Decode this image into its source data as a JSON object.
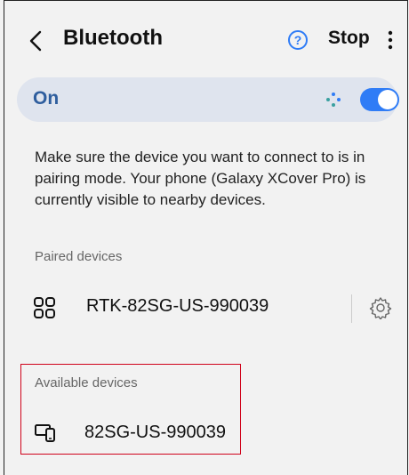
{
  "header": {
    "back_icon": "chevron-left-icon",
    "title": "Bluetooth",
    "help_icon": "help-circle-icon",
    "stop_label": "Stop",
    "more_icon": "more-vertical-icon"
  },
  "status": {
    "label": "On",
    "scan_icon": "scanning-dots-icon",
    "toggle_on": true,
    "accent_color": "#2f7cf6",
    "label_color": "#2f5e9e"
  },
  "description": "Make sure the device you want to connect to is in pairing mode. Your phone (Galaxy XCover Pro) is currently visible to nearby devices.",
  "paired": {
    "label": "Paired devices",
    "devices": [
      {
        "name": "RTK-82SG-US-990039",
        "icon": "device-grid-icon",
        "settings_icon": "gear-icon"
      }
    ]
  },
  "available": {
    "label": "Available devices",
    "devices": [
      {
        "name": "82SG-US-990039",
        "icon": "computer-phone-icon"
      }
    ],
    "highlight_color": "#d0021b"
  }
}
